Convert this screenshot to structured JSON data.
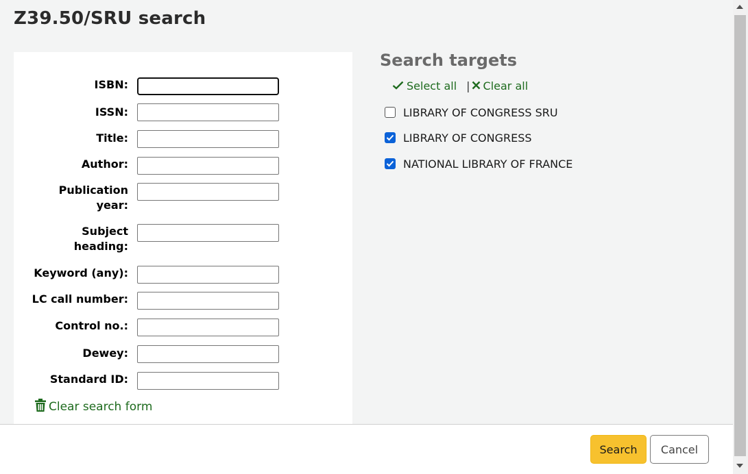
{
  "page": {
    "title": "Z39.50/SRU search"
  },
  "form": {
    "fields": [
      {
        "label": "ISBN:",
        "value": "",
        "focused": true
      },
      {
        "label": "ISSN:",
        "value": ""
      },
      {
        "label": "Title:",
        "value": ""
      },
      {
        "label": "Author:",
        "value": ""
      },
      {
        "label": "Publication year:",
        "value": ""
      },
      {
        "label": "Subject heading:",
        "value": ""
      },
      {
        "label": "Keyword (any):",
        "value": ""
      },
      {
        "label": "LC call number:",
        "value": ""
      },
      {
        "label": "Control no.:",
        "value": ""
      },
      {
        "label": "Dewey:",
        "value": ""
      },
      {
        "label": "Standard ID:",
        "value": ""
      }
    ],
    "clear_label": "Clear search form",
    "clear_icon": "trash-icon"
  },
  "targets": {
    "title": "Search targets",
    "select_all": "Select all",
    "separator": "|",
    "clear_all": "Clear all",
    "items": [
      {
        "label": "LIBRARY OF CONGRESS SRU",
        "checked": false
      },
      {
        "label": "LIBRARY OF CONGRESS",
        "checked": true
      },
      {
        "label": "NATIONAL LIBRARY OF FRANCE",
        "checked": true
      }
    ]
  },
  "footer": {
    "search_label": "Search",
    "cancel_label": "Cancel"
  },
  "colors": {
    "accent_link": "#1e6b1e",
    "search_button": "#f7c12e",
    "checkbox": "#0b62d8"
  }
}
